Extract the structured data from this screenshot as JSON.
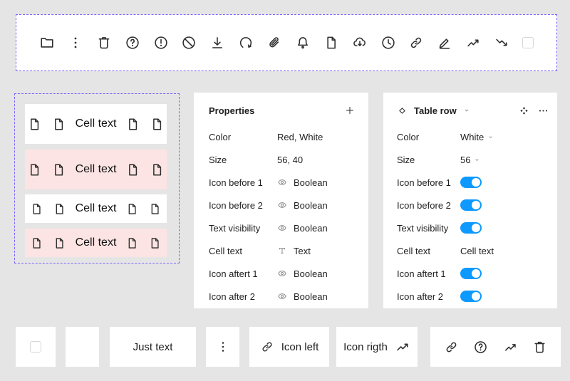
{
  "colors": {
    "canvas": "#E5E5E5",
    "selection_dashed": "#7B61FF",
    "panel_bg": "#FFFFFF",
    "row_pink": "#FBE4E3",
    "toggle_on": "#0D99FF",
    "icon": "#2C2C2C",
    "icon_muted": "#8A8A8A",
    "checkbox_border": "#D7D7D7",
    "text": "#1E1E1E"
  },
  "toolbar": {
    "icons": [
      "folder",
      "kebab-menu",
      "trash",
      "help",
      "warning",
      "block",
      "download",
      "refresh",
      "paperclip",
      "bell",
      "file",
      "cloud-download",
      "clock",
      "link",
      "edit",
      "trending-up",
      "trending-down",
      "checkbox-empty"
    ]
  },
  "table_preview": {
    "row_icon": "file",
    "rows": [
      {
        "text": "Cell text",
        "color": "white",
        "size": 56
      },
      {
        "text": "Cell text",
        "color": "pink",
        "size": 56
      },
      {
        "text": "Cell text",
        "color": "white",
        "size": 40
      },
      {
        "text": "Cell text",
        "color": "pink",
        "size": 40
      }
    ]
  },
  "properties_panel": {
    "title": "Properties",
    "add_icon": "plus",
    "rows": [
      {
        "label": "Color",
        "value": "Red, White",
        "icon": ""
      },
      {
        "label": "Size",
        "value": "56, 40",
        "icon": ""
      },
      {
        "label": "Icon before 1",
        "value": "Boolean",
        "icon": "eye"
      },
      {
        "label": "Icon before 2",
        "value": "Boolean",
        "icon": "eye"
      },
      {
        "label": "Text visibility",
        "value": "Boolean",
        "icon": "eye"
      },
      {
        "label": "Cell text",
        "value": "Text",
        "icon": "text-style"
      },
      {
        "label": "Icon aftert 1",
        "value": "Boolean",
        "icon": "eye"
      },
      {
        "label": "Icon after 2",
        "value": "Boolean",
        "icon": "eye"
      }
    ]
  },
  "instance_panel": {
    "title": "Table row",
    "header_icons": [
      "diamond",
      "chevron-down",
      "swap",
      "more"
    ],
    "rows": [
      {
        "label": "Color",
        "control": "dropdown",
        "value": "White"
      },
      {
        "label": "Size",
        "control": "dropdown",
        "value": "56"
      },
      {
        "label": "Icon before 1",
        "control": "toggle",
        "on": true
      },
      {
        "label": "Icon before 2",
        "control": "toggle",
        "on": true
      },
      {
        "label": "Text visibility",
        "control": "toggle",
        "on": true
      },
      {
        "label": "Cell text",
        "control": "text",
        "value": "Cell text"
      },
      {
        "label": "Icon aftert 1",
        "control": "toggle",
        "on": true
      },
      {
        "label": "Icon after 2",
        "control": "toggle",
        "on": true
      }
    ]
  },
  "bottom_cells": [
    {
      "type": "checkbox",
      "icon": "checkbox-empty"
    },
    {
      "type": "empty"
    },
    {
      "type": "text",
      "text": "Just text"
    },
    {
      "type": "icon",
      "icon": "kebab-menu"
    },
    {
      "type": "icon-text",
      "icon": "link",
      "text": "Icon left"
    },
    {
      "type": "text-icon",
      "icon": "trending-up",
      "text": "Icon rigth"
    },
    {
      "type": "icons",
      "icons": [
        "link",
        "help",
        "trending-up",
        "trash"
      ]
    }
  ]
}
